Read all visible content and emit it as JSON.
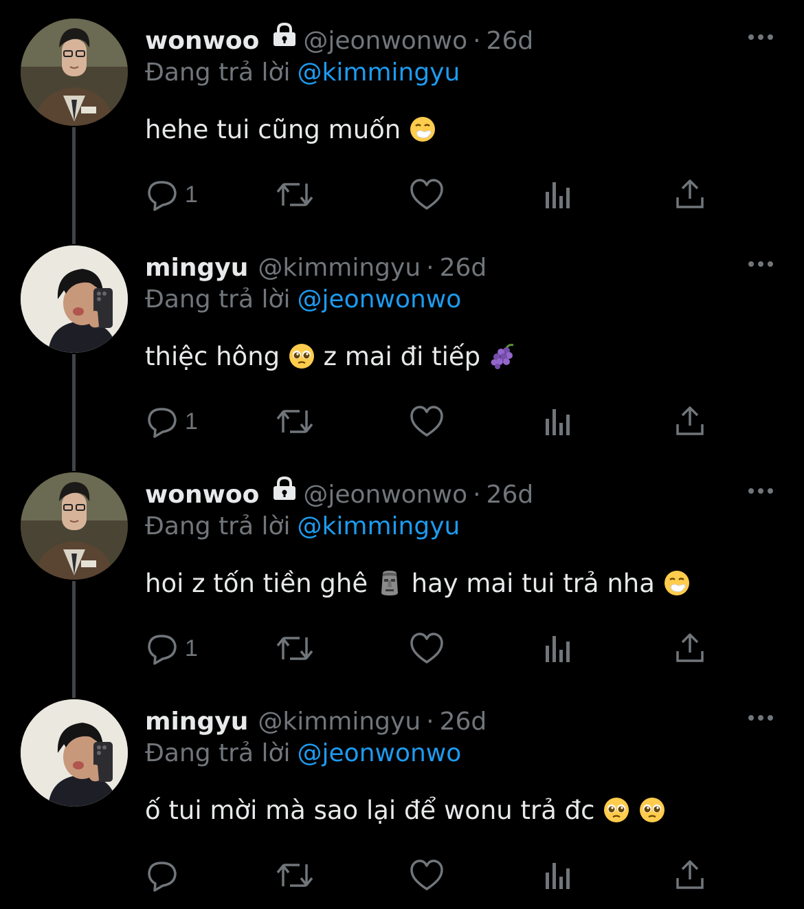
{
  "tweets": [
    {
      "author": "wonwoo",
      "protected": true,
      "handle": "@jeonwonwo",
      "separator": "·",
      "time": "26d",
      "reply_prefix": "Đang trả lời",
      "reply_to": "@kimmingyu",
      "text_segments": [
        "hehe tui cũng muốn "
      ],
      "emojis": [
        "sneezing-face-emoji"
      ],
      "reply_count": "1",
      "avatar": "wonwoo-avatar"
    },
    {
      "author": "mingyu",
      "protected": false,
      "handle": "@kimmingyu",
      "separator": "·",
      "time": "26d",
      "reply_prefix": "Đang trả lời",
      "reply_to": "@jeonwonwo",
      "text_segments": [
        "thiệc hông ",
        "  z mai đi tiếp "
      ],
      "emojis": [
        "pleading-face-emoji",
        "grapes-emoji"
      ],
      "reply_count": "1",
      "avatar": "mingyu-avatar"
    },
    {
      "author": "wonwoo",
      "protected": true,
      "handle": "@jeonwonwo",
      "separator": "·",
      "time": "26d",
      "reply_prefix": "Đang trả lời",
      "reply_to": "@kimmingyu",
      "text_segments": [
        "hoi z tốn tiền ghê ",
        "  hay mai tui trả nha "
      ],
      "emojis": [
        "moai-emoji",
        "sneezing-face-emoji"
      ],
      "reply_count": "1",
      "avatar": "wonwoo-avatar"
    },
    {
      "author": "mingyu",
      "protected": false,
      "handle": "@kimmingyu",
      "separator": "·",
      "time": "26d",
      "reply_prefix": "Đang trả lời",
      "reply_to": "@jeonwonwo",
      "text_segments": [
        "ố tui mời mà sao lại để wonu trả đc ",
        " "
      ],
      "emojis": [
        "pleading-face-emoji",
        "pleading-face-emoji"
      ],
      "reply_count": "",
      "avatar": "mingyu-avatar"
    }
  ],
  "icons": {
    "more": "more-horizontal-icon",
    "reply": "reply-icon",
    "retweet": "retweet-icon",
    "like": "like-icon",
    "views": "views-icon",
    "share": "share-icon",
    "lock": "lock-icon"
  },
  "colors": {
    "background": "#000000",
    "text": "#e7e9ea",
    "secondary": "#71767b",
    "link": "#1d9bf0",
    "thread_line": "#3f4449"
  }
}
